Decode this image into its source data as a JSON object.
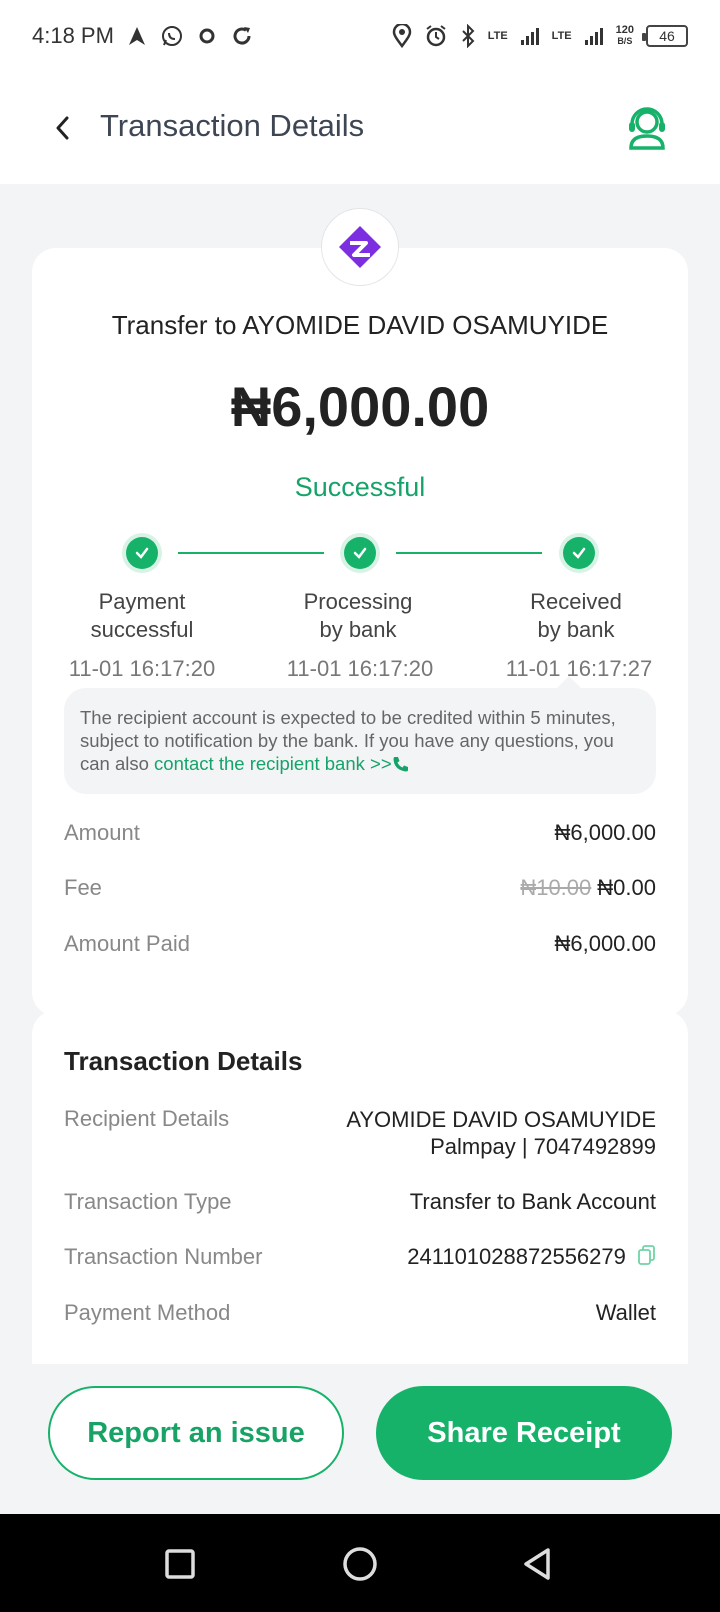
{
  "status_bar": {
    "time": "4:18 PM",
    "net_speed_value": "120",
    "net_speed_unit": "B/S",
    "battery": "46",
    "lte1": "LTE",
    "lte2": "LTE"
  },
  "header": {
    "title": "Transaction Details"
  },
  "summary": {
    "recipient_line": "Transfer to AYOMIDE DAVID OSAMUYIDE",
    "amount": "₦6,000.00",
    "status": "Successful",
    "steps": [
      {
        "label_line1": "Payment",
        "label_line2": "successful",
        "time": "11-01 16:17:20"
      },
      {
        "label_line1": "Processing",
        "label_line2": "by bank",
        "time": "11-01 16:17:20"
      },
      {
        "label_line1": "Received",
        "label_line2": "by bank",
        "time": "11-01 16:17:27"
      }
    ],
    "notice_text": "The recipient account is expected to be credited within 5 minutes, subject to notification by the bank. If you have any questions, you can also ",
    "notice_link": "contact the recipient bank >>",
    "rows": {
      "amount_label": "Amount",
      "amount_value": "₦6,000.00",
      "fee_label": "Fee",
      "fee_original": "₦10.00",
      "fee_value": "₦0.00",
      "paid_label": "Amount Paid",
      "paid_value": "₦6,000.00"
    }
  },
  "details": {
    "heading": "Transaction Details",
    "recipient_label": "Recipient Details",
    "recipient_name": "AYOMIDE DAVID OSAMUYIDE",
    "recipient_account": "Palmpay | 7047492899",
    "type_label": "Transaction Type",
    "type_value": "Transfer to Bank Account",
    "number_label": "Transaction Number",
    "number_value": "241101028872556279",
    "method_label": "Payment Method",
    "method_value": "Wallet"
  },
  "actions": {
    "report": "Report an issue",
    "share": "Share Receipt"
  },
  "colors": {
    "accent": "#17b26a",
    "logo": "#7b2fe0"
  }
}
